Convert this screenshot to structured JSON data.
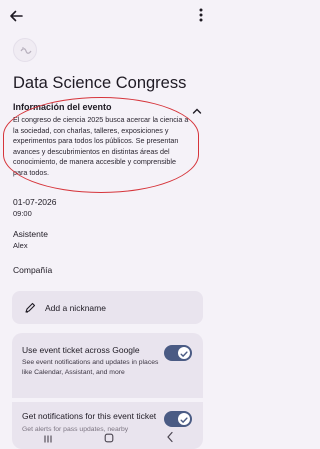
{
  "header": {
    "back_icon": "arrow-left-icon",
    "menu_icon": "more-vertical-icon"
  },
  "event": {
    "logo_icon": "event-logo-icon",
    "title": "Data Science Congress",
    "info_header": "Información del evento",
    "info_body": "El congreso de ciencia 2025 busca acercar la ciencia a la sociedad, con charlas, talleres, exposiciones y experimentos para todos los públicos. Se presentan avances y descubrimientos en distintas áreas del conocimiento, de manera accesible y comprensible para todos.",
    "date": "01-07-2026",
    "time": "09:00",
    "attendee_label": "Asistente",
    "attendee_value": "Alex",
    "company_label": "Compañía"
  },
  "nickname": {
    "label": "Add a nickname",
    "icon": "pencil-icon"
  },
  "settings": {
    "row1_title": "Use event ticket across Google",
    "row1_desc": "See event notifications and updates in places like Calendar, Assistant, and more",
    "row1_on": true,
    "row2_title": "Get notifications for this event ticket",
    "row2_desc": "Get alerts for pass updates, nearby",
    "row2_on": true
  },
  "colors": {
    "background": "#f5f2f8",
    "card": "#e9e4ee",
    "toggle_on": "#4a5b84",
    "annotation": "#d6353b"
  },
  "navbar": {
    "recents_icon": "recents-icon",
    "home_icon": "home-icon",
    "back_icon": "back-chevron-icon"
  }
}
